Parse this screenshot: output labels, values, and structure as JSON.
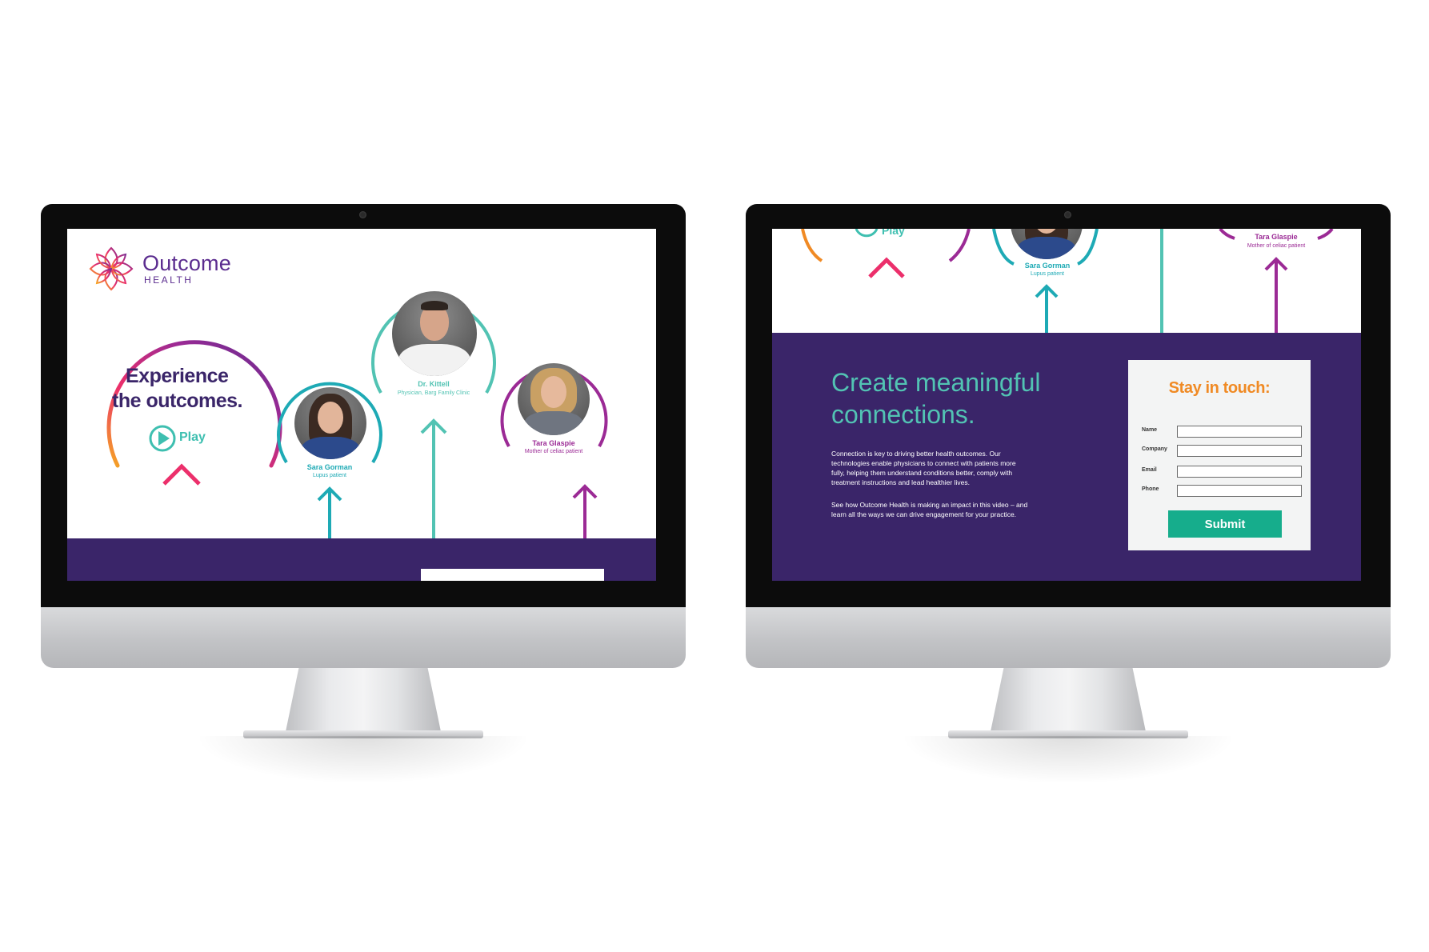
{
  "brand": {
    "name_line1": "Outcome",
    "name_line2": "HEALTH"
  },
  "hero": {
    "headline_line1": "Experience",
    "headline_line2": "the outcomes.",
    "play_label": "Play"
  },
  "people": [
    {
      "name": "Sara Gorman",
      "role": "Lupus patient"
    },
    {
      "name": "Dr. Kittell",
      "role": "Physician, Barg Family Clinic"
    },
    {
      "name": "Tara Glaspie",
      "role": "Mother of celiac patient"
    }
  ],
  "connections": {
    "heading_line1": "Create meaningful",
    "heading_line2": "connections.",
    "paragraph1": [
      "Connection is key to driving better health outcomes. Our",
      "technologies enable physicians to connect with patients more",
      "fully, helping them understand conditions better, comply with",
      "treatment instructions and lead healthier lives."
    ],
    "paragraph2": [
      "See how Outcome Health is making an impact in this video – and",
      "learn all the ways we can drive engagement for your practice."
    ]
  },
  "contact_form": {
    "title": "Stay in touch:",
    "fields": [
      "Name",
      "Company",
      "Email",
      "Phone"
    ],
    "submit_label": "Submit"
  },
  "colors": {
    "purple": "#3a2569",
    "teal": "#52c3b3",
    "cyan": "#1eaab5",
    "magenta": "#9b2a95",
    "orange": "#f08a24",
    "submit_green": "#16ad8c"
  }
}
